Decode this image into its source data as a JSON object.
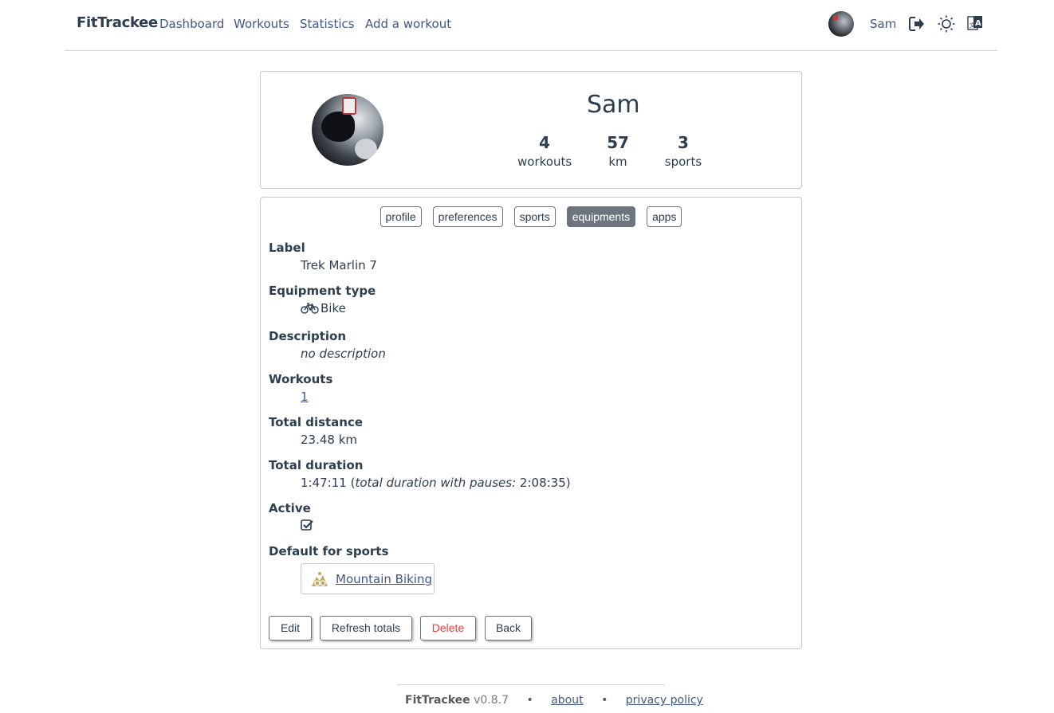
{
  "navbar": {
    "brand": "FitTrackee",
    "links": [
      "Dashboard",
      "Workouts",
      "Statistics",
      "Add a workout"
    ],
    "username": "Sam",
    "icons": [
      "avatar",
      "logout-icon",
      "sun-icon",
      "language-icon"
    ]
  },
  "profile": {
    "name": "Sam",
    "stats": [
      {
        "value": "4",
        "label": "workouts"
      },
      {
        "value": "57",
        "label": "km"
      },
      {
        "value": "3",
        "label": "sports"
      }
    ]
  },
  "tabs": {
    "items": [
      "profile",
      "preferences",
      "sports",
      "equipments",
      "apps"
    ],
    "active": "equipments"
  },
  "equipment": {
    "label_title": "Label",
    "label_value": "Trek Marlin 7",
    "type_title": "Equipment type",
    "type_value": "Bike",
    "description_title": "Description",
    "description_value": "no description",
    "workouts_title": "Workouts",
    "workouts_value": "1",
    "distance_title": "Total distance",
    "distance_value": "23.48 km",
    "duration_title": "Total duration",
    "duration_value": "1:47:11",
    "duration_pauses_label": "total duration with pauses:",
    "duration_pauses_value": "2:08:35",
    "active_title": "Active",
    "active_checked": true,
    "default_sports_title": "Default for sports",
    "default_sport": "Mountain Biking",
    "sport_color": "#c5a560"
  },
  "actions": {
    "edit": "Edit",
    "refresh": "Refresh totals",
    "delete": "Delete",
    "back": "Back"
  },
  "footer": {
    "brand": "FitTrackee",
    "version": "v0.8.7",
    "about": "about",
    "privacy": "privacy policy"
  },
  "colors": {
    "text": "#2c3e50",
    "link": "#40578a",
    "active_tab": "#6c757d",
    "danger": "#e53e3e"
  }
}
